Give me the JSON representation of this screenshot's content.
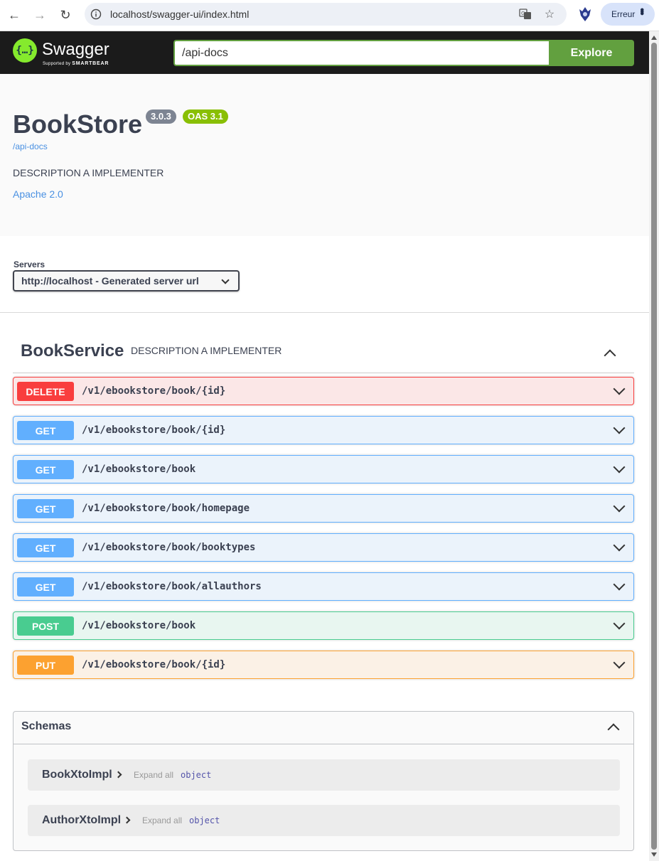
{
  "browser": {
    "url": "localhost/swagger-ui/index.html",
    "profile_label": "Erreur"
  },
  "topbar": {
    "logo_text": "Swagger",
    "logo_sub_prefix": "Supported by",
    "logo_sub_brand": "SMARTBEAR",
    "spec_url": "/api-docs",
    "explore_label": "Explore"
  },
  "info": {
    "title": "BookStore",
    "version": "3.0.3",
    "oas": "OAS 3.1",
    "spec_link": "/api-docs",
    "description": "DESCRIPTION A IMPLEMENTER",
    "license": "Apache 2.0"
  },
  "servers": {
    "label": "Servers",
    "selected": "http://localhost - Generated server url"
  },
  "tag": {
    "name": "BookService",
    "description": "DESCRIPTION A IMPLEMENTER"
  },
  "operations": [
    {
      "method": "DELETE",
      "path": "/v1/ebookstore/book/{id}"
    },
    {
      "method": "GET",
      "path": "/v1/ebookstore/book/{id}"
    },
    {
      "method": "GET",
      "path": "/v1/ebookstore/book"
    },
    {
      "method": "GET",
      "path": "/v1/ebookstore/book/homepage"
    },
    {
      "method": "GET",
      "path": "/v1/ebookstore/book/booktypes"
    },
    {
      "method": "GET",
      "path": "/v1/ebookstore/book/allauthors"
    },
    {
      "method": "POST",
      "path": "/v1/ebookstore/book"
    },
    {
      "method": "PUT",
      "path": "/v1/ebookstore/book/{id}"
    }
  ],
  "schemas": {
    "title": "Schemas",
    "models": [
      {
        "name": "BookXtoImpl",
        "expand": "Expand all",
        "type": "object"
      },
      {
        "name": "AuthorXtoImpl",
        "expand": "Expand all",
        "type": "object"
      }
    ]
  },
  "colors": {
    "delete": "#f93e3e",
    "get": "#61affe",
    "post": "#49cc90",
    "put": "#fca130",
    "explore": "#62a03f",
    "logo": "#85ea2d"
  }
}
